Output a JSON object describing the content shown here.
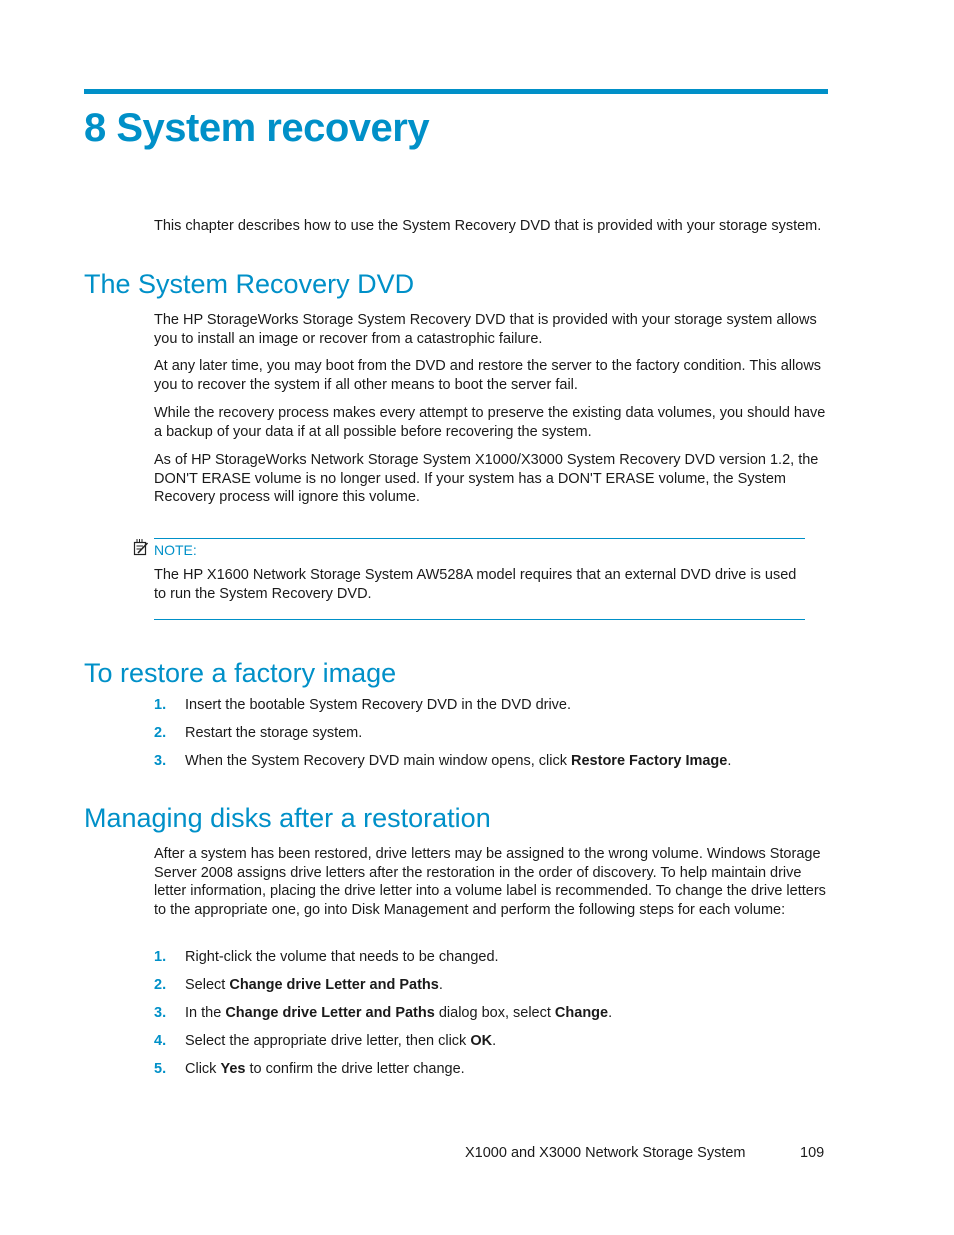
{
  "chapter": {
    "title": "8 System recovery",
    "intro": "This chapter describes how to use the System Recovery DVD that is provided with your storage system."
  },
  "sections": {
    "dvd": {
      "title": "The System Recovery DVD",
      "paragraphs": [
        "The HP StorageWorks Storage System Recovery DVD that is provided with your storage system allows you to install an image or recover from a catastrophic failure.",
        "At any later time, you may boot from the DVD and restore the server to the factory condition. This allows you to recover the system if all other means to boot the server fail.",
        "While the recovery process makes every attempt to preserve the existing data volumes, you should have a backup of your data if at all possible before recovering the system.",
        "As of HP StorageWorks Network Storage System X1000/X3000 System Recovery DVD version 1.2, the DON'T ERASE volume is no longer used. If your system has a DON'T ERASE volume, the System Recovery process will ignore this volume."
      ],
      "note": {
        "icon": "note-icon",
        "label": "NOTE:",
        "text": "The HP X1600 Network Storage System AW528A model requires that an external DVD drive is used to run the System Recovery DVD."
      }
    },
    "restore": {
      "title": "To restore a factory image",
      "steps": [
        {
          "num": "1.",
          "text": "Insert the bootable System Recovery DVD in the DVD drive."
        },
        {
          "num": "2.",
          "text": "Restart the storage system."
        },
        {
          "num": "3.",
          "text": "When the System Recovery DVD main window opens, click ",
          "bold": "Restore Factory Image",
          "after": "."
        }
      ]
    },
    "managing": {
      "title": "Managing disks after a restoration",
      "paragraph": "After a system has been restored, drive letters may be assigned to the wrong volume. Windows Storage Server 2008 assigns drive letters after the restoration in the order of discovery. To help maintain drive letter information, placing the drive letter into a volume label is recommended. To change the drive letters to the appropriate one, go into Disk Management and perform the following steps for each volume:",
      "steps": [
        {
          "num": "1.",
          "text": "Right-click the volume that needs to be changed."
        },
        {
          "num": "2.",
          "pre": "Select ",
          "bold": "Change drive Letter and Paths",
          "after": "."
        },
        {
          "num": "3.",
          "pre": "In the ",
          "bold": "Change drive Letter and Paths",
          "mid": " dialog box, select ",
          "bold2": "Change",
          "after": "."
        },
        {
          "num": "4.",
          "pre": "Select the appropriate drive letter, then click ",
          "bold": "OK",
          "after": "."
        },
        {
          "num": "5.",
          "pre": "Click ",
          "bold": "Yes",
          "after": " to confirm the drive letter change."
        }
      ]
    }
  },
  "footer": {
    "doc_title": "X1000 and X3000 Network Storage System",
    "page_number": "109"
  }
}
